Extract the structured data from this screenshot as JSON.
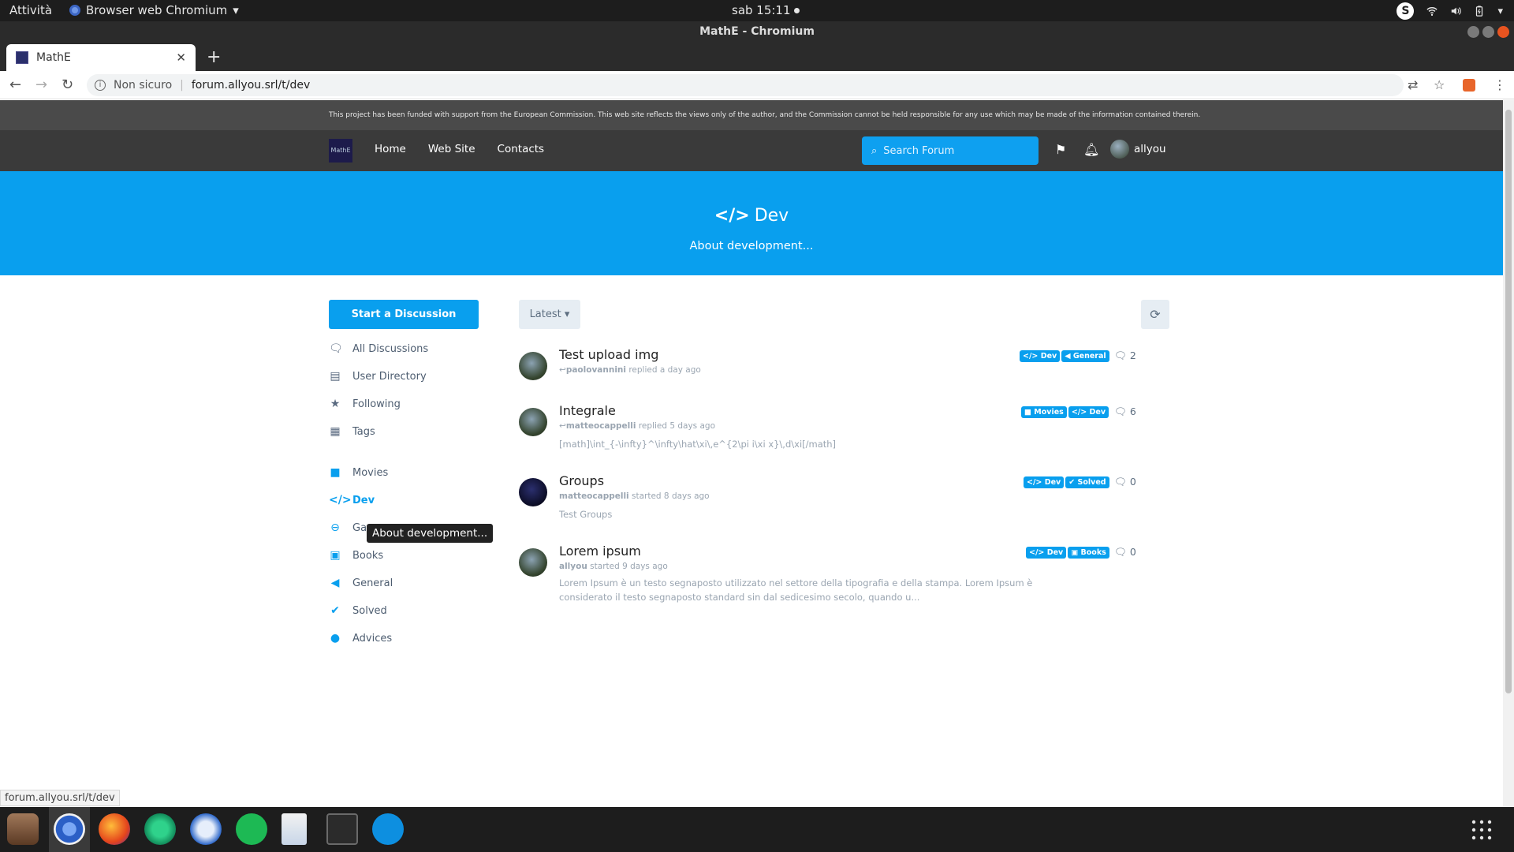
{
  "system_bar": {
    "activities": "Attività",
    "app_menu": "Browser web Chromium",
    "clock": "sab 15:11"
  },
  "window": {
    "title": "MathE - Chromium"
  },
  "tab": {
    "title": "MathE"
  },
  "omnibox": {
    "security": "Non sicuro",
    "url": "forum.allyou.srl/t/dev"
  },
  "site": {
    "eu_notice": "This project has been funded with support from the European Commission. This web site reflects the views only of the author, and the Commission cannot be held responsible for any use which may be made of the information contained therein.",
    "nav": [
      "Home",
      "Web Site",
      "Contacts"
    ],
    "search_placeholder": "Search Forum",
    "username": "allyou",
    "accent_color": "#099fee"
  },
  "hero": {
    "title": "Dev",
    "description": "About development..."
  },
  "sidebar": {
    "start_button": "Start a Discussion",
    "items": [
      {
        "label": "All Discussions",
        "icon": "comments-icon"
      },
      {
        "label": "User Directory",
        "icon": "address-book-icon"
      },
      {
        "label": "Following",
        "icon": "star-icon"
      },
      {
        "label": "Tags",
        "icon": "grid-icon"
      }
    ],
    "tags": [
      {
        "label": "Movies",
        "icon": "video-icon"
      },
      {
        "label": "Dev",
        "icon": "code-icon",
        "active": true
      },
      {
        "label": "Ga",
        "icon": "gamepad-icon"
      },
      {
        "label": "Books",
        "icon": "book-icon"
      },
      {
        "label": "General",
        "icon": "bullhorn-icon"
      },
      {
        "label": "Solved",
        "icon": "check-icon"
      },
      {
        "label": "Advices",
        "icon": "comment-dots-icon"
      }
    ],
    "tooltip": "About development..."
  },
  "toolbar": {
    "sort": "Latest"
  },
  "discussions": [
    {
      "title": "Test upload img",
      "user": "paolovannini",
      "action": "replied a day ago",
      "reply_icon": true,
      "excerpt": "",
      "tags": [
        "Dev",
        "General"
      ],
      "replies": "2"
    },
    {
      "title": "Integrale",
      "user": "matteocappelli",
      "action": "replied 5 days ago",
      "reply_icon": true,
      "excerpt": "[math]\\int_{-\\infty}^\\infty\\hat\\xi\\,e^{2\\pi i\\xi x}\\,d\\xi[/math]",
      "tags": [
        "Movies",
        "Dev"
      ],
      "replies": "6"
    },
    {
      "title": "Groups",
      "user": "matteocappelli",
      "action": "started 8 days ago",
      "reply_icon": false,
      "excerpt": "Test Groups",
      "tags": [
        "Dev",
        "Solved"
      ],
      "replies": "0"
    },
    {
      "title": "Lorem ipsum",
      "user": "allyou",
      "action": "started 9 days ago",
      "reply_icon": false,
      "excerpt": "Lorem Ipsum è un testo segnaposto utilizzato nel settore della tipografia e della stampa. Lorem Ipsum è considerato il testo segnaposto standard sin dal sedicesimo secolo, quando u...",
      "tags": [
        "Dev",
        "Books"
      ],
      "replies": "0"
    }
  ],
  "status_url": "forum.allyou.srl/t/dev"
}
